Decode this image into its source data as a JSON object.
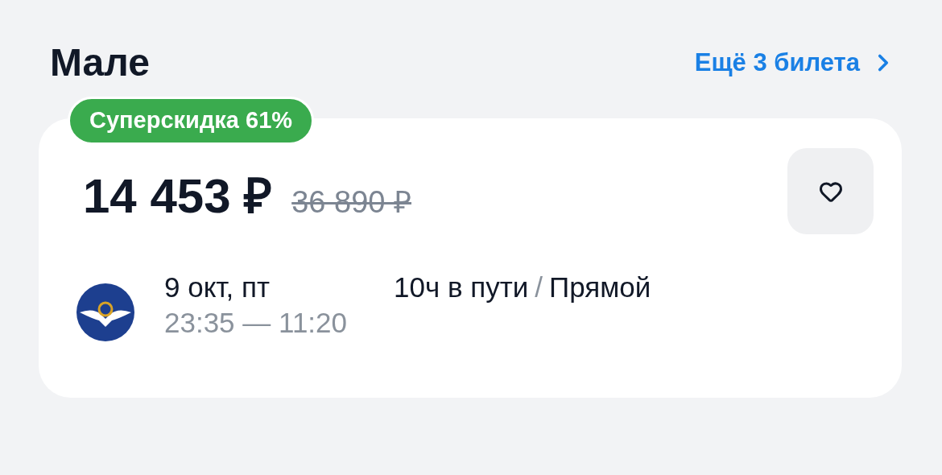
{
  "title": "Мале",
  "more_link": {
    "label": "Ещё 3 билета"
  },
  "card": {
    "badge": "Суперскидка 61%",
    "price": "14 453 ₽",
    "old_price": "36 890 ₽",
    "favorite": {
      "selected": false
    },
    "flight": {
      "date": "9 окт, пт",
      "times": "23:35 — 11:20",
      "duration": "10ч в пути",
      "separator": "/",
      "stops": "Прямой"
    }
  }
}
